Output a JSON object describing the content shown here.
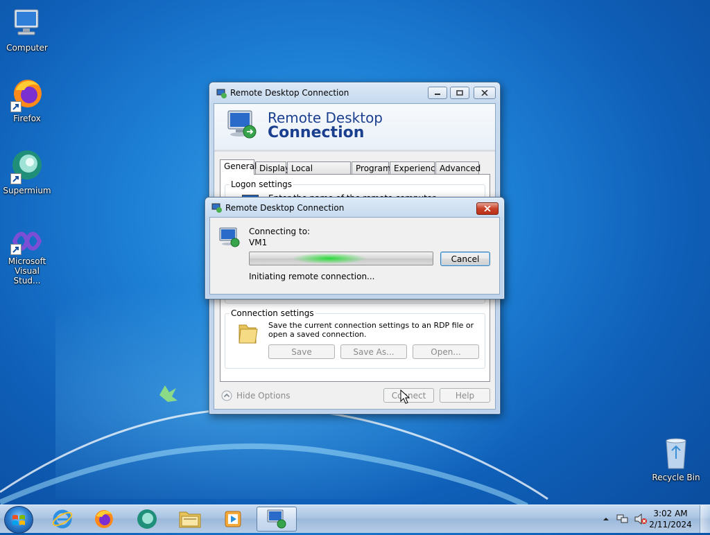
{
  "desktop": {
    "icons": [
      {
        "label": "Computer"
      },
      {
        "label": "Firefox"
      },
      {
        "label": "Supermium"
      },
      {
        "label": "Microsoft Visual Stud..."
      },
      {
        "label": "Recycle Bin"
      }
    ]
  },
  "rdc_main": {
    "title": "Remote Desktop Connection",
    "banner_line1": "Remote Desktop",
    "banner_line2": "Connection",
    "tabs": [
      "General",
      "Display",
      "Local Resources",
      "Programs",
      "Experience",
      "Advanced"
    ],
    "logon_settings_label": "Logon settings",
    "logon_hint": "Enter the name of the remote computer.",
    "connection_settings_label": "Connection settings",
    "connection_settings_text": "Save the current connection settings to an RDP file or open a saved connection.",
    "save_label": "Save",
    "save_as_label": "Save As...",
    "open_label": "Open...",
    "hide_options_label": "Hide Options",
    "connect_label": "Connect",
    "help_label": "Help"
  },
  "rdc_progress": {
    "title": "Remote Desktop Connection",
    "connecting_to_label": "Connecting to:",
    "computer_name": "VM1",
    "cancel_label": "Cancel",
    "status_text": "Initiating remote connection..."
  },
  "taskbar": {
    "items": [
      "start-button",
      "internet-explorer-icon",
      "firefox-icon",
      "supermium-icon",
      "file-explorer-icon",
      "media-player-icon",
      "remote-desktop-icon"
    ],
    "clock_time": "3:02 AM",
    "clock_date": "2/11/2024"
  },
  "colors": {
    "banner_text": "#1b3f8f",
    "desktop_blue": "#1d7fd4"
  }
}
